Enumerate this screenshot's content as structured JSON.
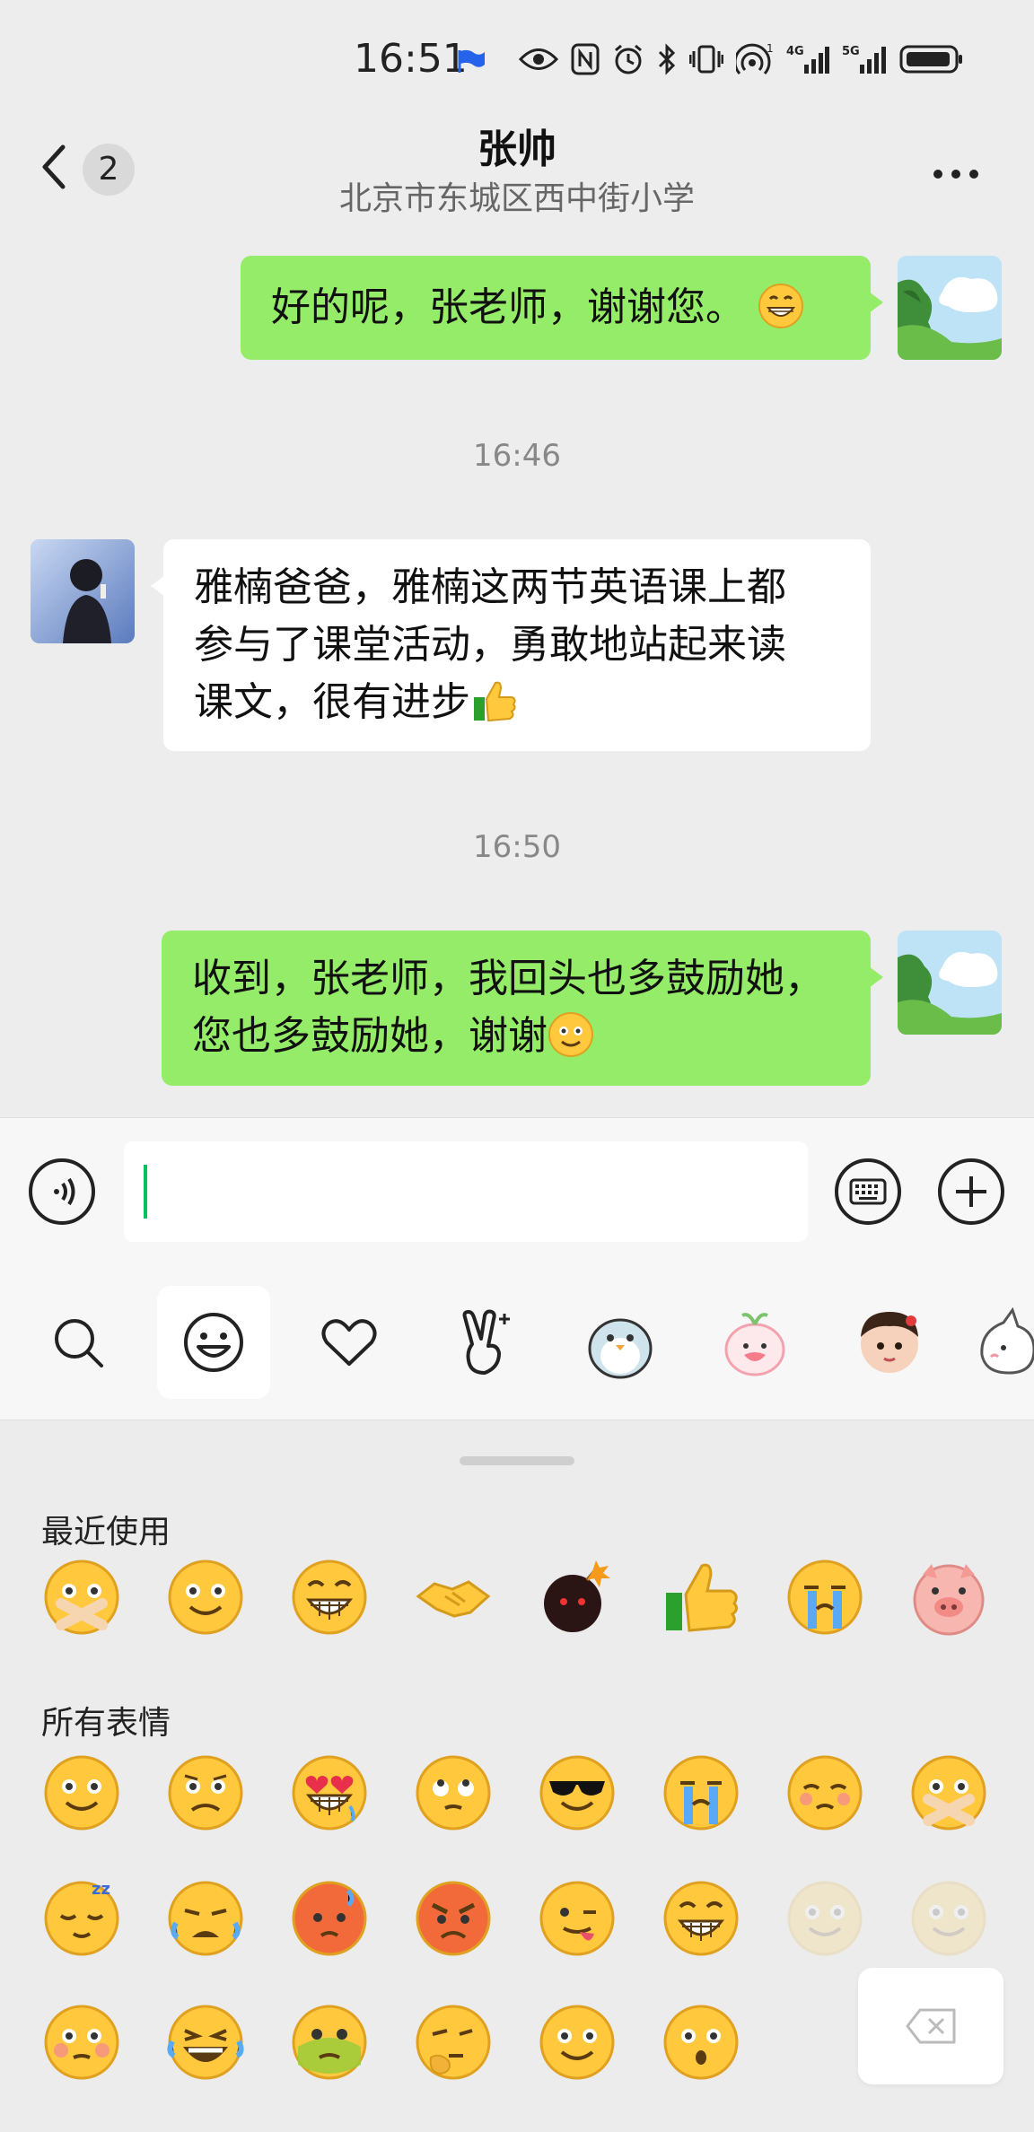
{
  "status_bar": {
    "time": "16:51",
    "icons": [
      "flag-icon",
      "eye-icon",
      "nfc-icon",
      "alarm-icon",
      "bluetooth-icon",
      "vibrate-icon",
      "hotspot-icon",
      "signal-4g-icon",
      "signal-5g-icon",
      "battery-icon"
    ]
  },
  "header": {
    "back_badge": "2",
    "title": "张帅",
    "subtitle": "北京市东城区西中街小学",
    "more_icon": "more-icon"
  },
  "messages": [
    {
      "side": "me",
      "text": "好的呢，张老师，谢谢您。",
      "emoji": "grin-emoji"
    },
    {
      "timestamp": "16:46"
    },
    {
      "side": "them",
      "lines": [
        "雅楠爸爸，雅楠这两节英语课上都",
        "参与了课堂活动，勇敢地站起来读",
        "课文，很有进步"
      ],
      "emoji": "thumbs-up-emoji"
    },
    {
      "timestamp": "16:50"
    },
    {
      "side": "me",
      "lines": [
        "收到，张老师，我回头也多鼓励她，",
        "您也多鼓励她，谢谢"
      ],
      "emoji": "smile-emoji"
    }
  ],
  "input_bar": {
    "voice_icon": "voice-icon",
    "keyboard_icon": "keyboard-icon",
    "plus_icon": "plus-icon",
    "text_value": ""
  },
  "sticker_tabs": [
    "search-icon",
    "emoji-icon",
    "heart-icon",
    "peace-hand-icon",
    "penguin-sticker",
    "peach-sticker",
    "baby-sticker",
    "cat-sticker"
  ],
  "emoji_panel": {
    "recent_label": "最近使用",
    "all_label": "所有表情",
    "recent": [
      "shushing",
      "smile",
      "grin",
      "handshake",
      "bomb",
      "thumbs-up",
      "cry",
      "pig"
    ],
    "all_row1": [
      "smile",
      "worried",
      "heart-eyes",
      "rolling-eyes",
      "cool",
      "cry",
      "shy",
      "shushing"
    ],
    "all_row2": [
      "sleepy",
      "sob",
      "angry-red",
      "furious",
      "wink-tongue",
      "grin",
      "faded",
      "faded"
    ],
    "all_row3": [
      "blush",
      "laugh-cry",
      "sick",
      "thinking",
      "happy",
      "surprised"
    ],
    "delete_icon": "backspace-icon"
  }
}
